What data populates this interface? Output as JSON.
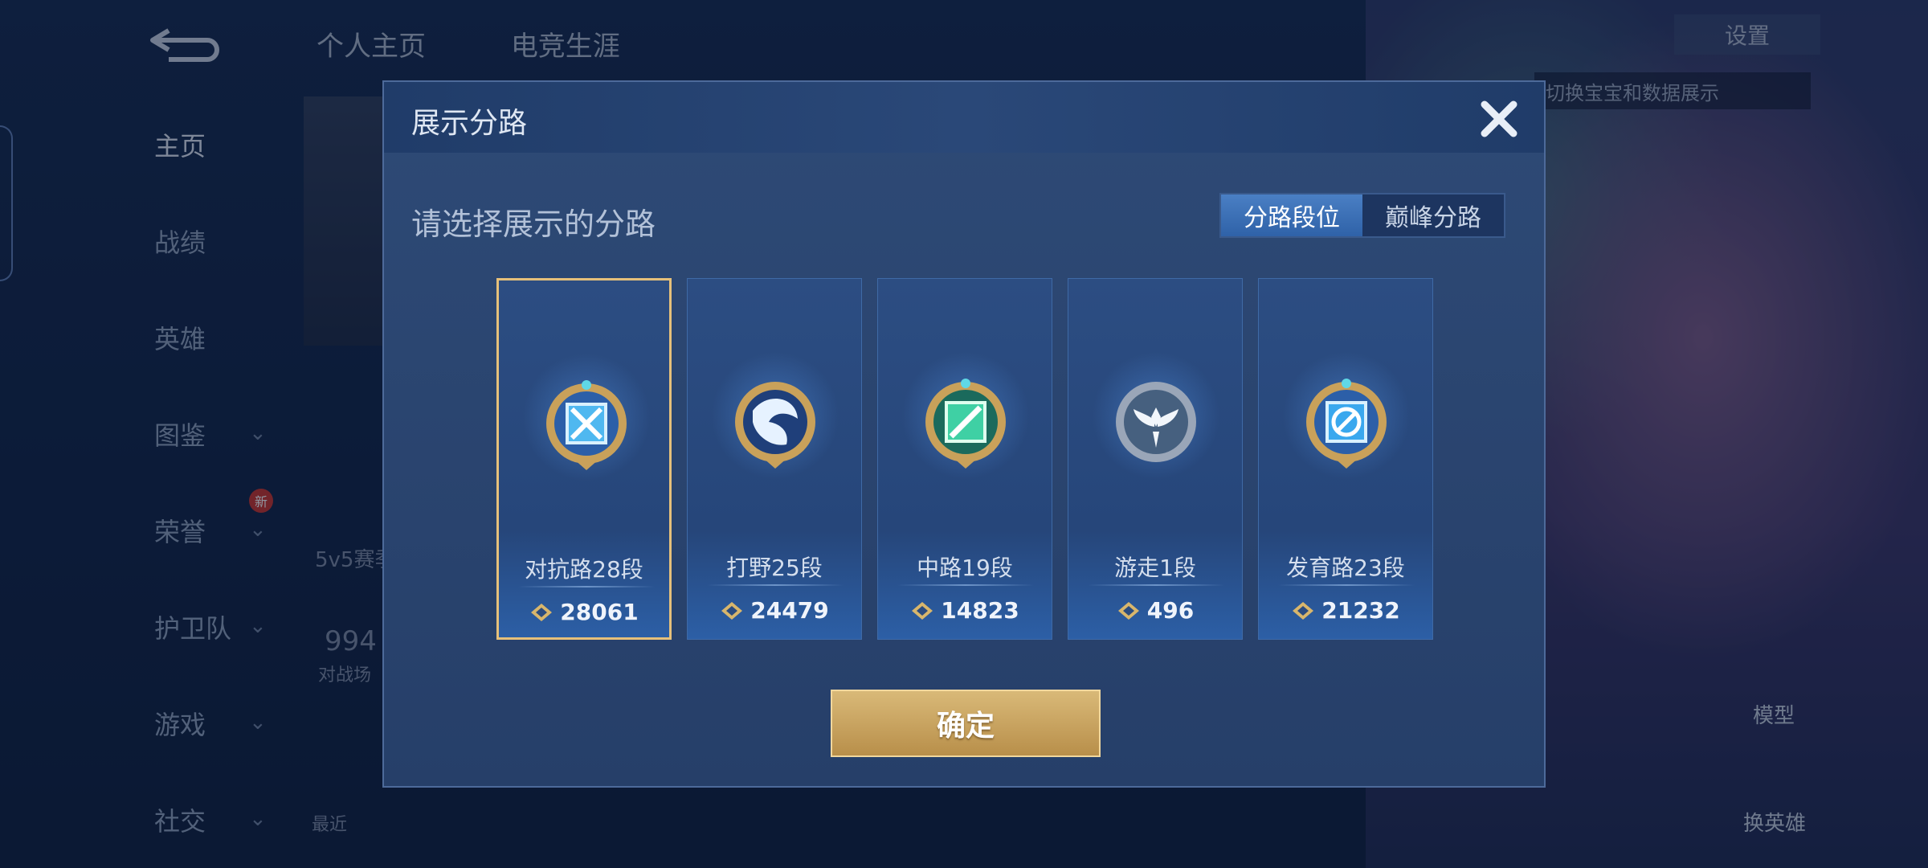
{
  "nav": {
    "items": [
      {
        "label": "主页"
      },
      {
        "label": "战绩"
      },
      {
        "label": "英雄"
      },
      {
        "label": "图鉴"
      },
      {
        "label": "荣誉"
      },
      {
        "label": "护卫队"
      },
      {
        "label": "游戏"
      },
      {
        "label": "社交"
      }
    ],
    "new_badge": "新"
  },
  "top_tabs": [
    "个人主页",
    "电竞生涯"
  ],
  "background": {
    "settings_label": "设置",
    "tip_text": "切换宝宝和数据展示",
    "mode_label": "5v5赛季",
    "stat_value": "994",
    "stat_caption": "对战场",
    "recent_label": "最近",
    "model_label": "模型",
    "swap_hero_label": "换英雄"
  },
  "dialog": {
    "title": "展示分路",
    "close_label": "✕",
    "prompt": "请选择展示的分路",
    "segment": [
      {
        "label": "分路段位",
        "active": true
      },
      {
        "label": "巅峰分路",
        "active": false
      }
    ],
    "lanes": [
      {
        "name": "对抗路28段",
        "score": "28061",
        "icon": "clash-lane-emblem",
        "selected": true
      },
      {
        "name": "打野25段",
        "score": "24479",
        "icon": "jungle-emblem",
        "selected": false
      },
      {
        "name": "中路19段",
        "score": "14823",
        "icon": "mid-lane-emblem",
        "selected": false
      },
      {
        "name": "游走1段",
        "score": "496",
        "icon": "roam-emblem",
        "selected": false
      },
      {
        "name": "发育路23段",
        "score": "21232",
        "icon": "farm-lane-emblem",
        "selected": false
      }
    ],
    "confirm_label": "确定"
  },
  "colors": {
    "accent_gold": "#e6c07a",
    "segment_active": "#3f74bb",
    "dialog_bg": "#2a4472"
  }
}
